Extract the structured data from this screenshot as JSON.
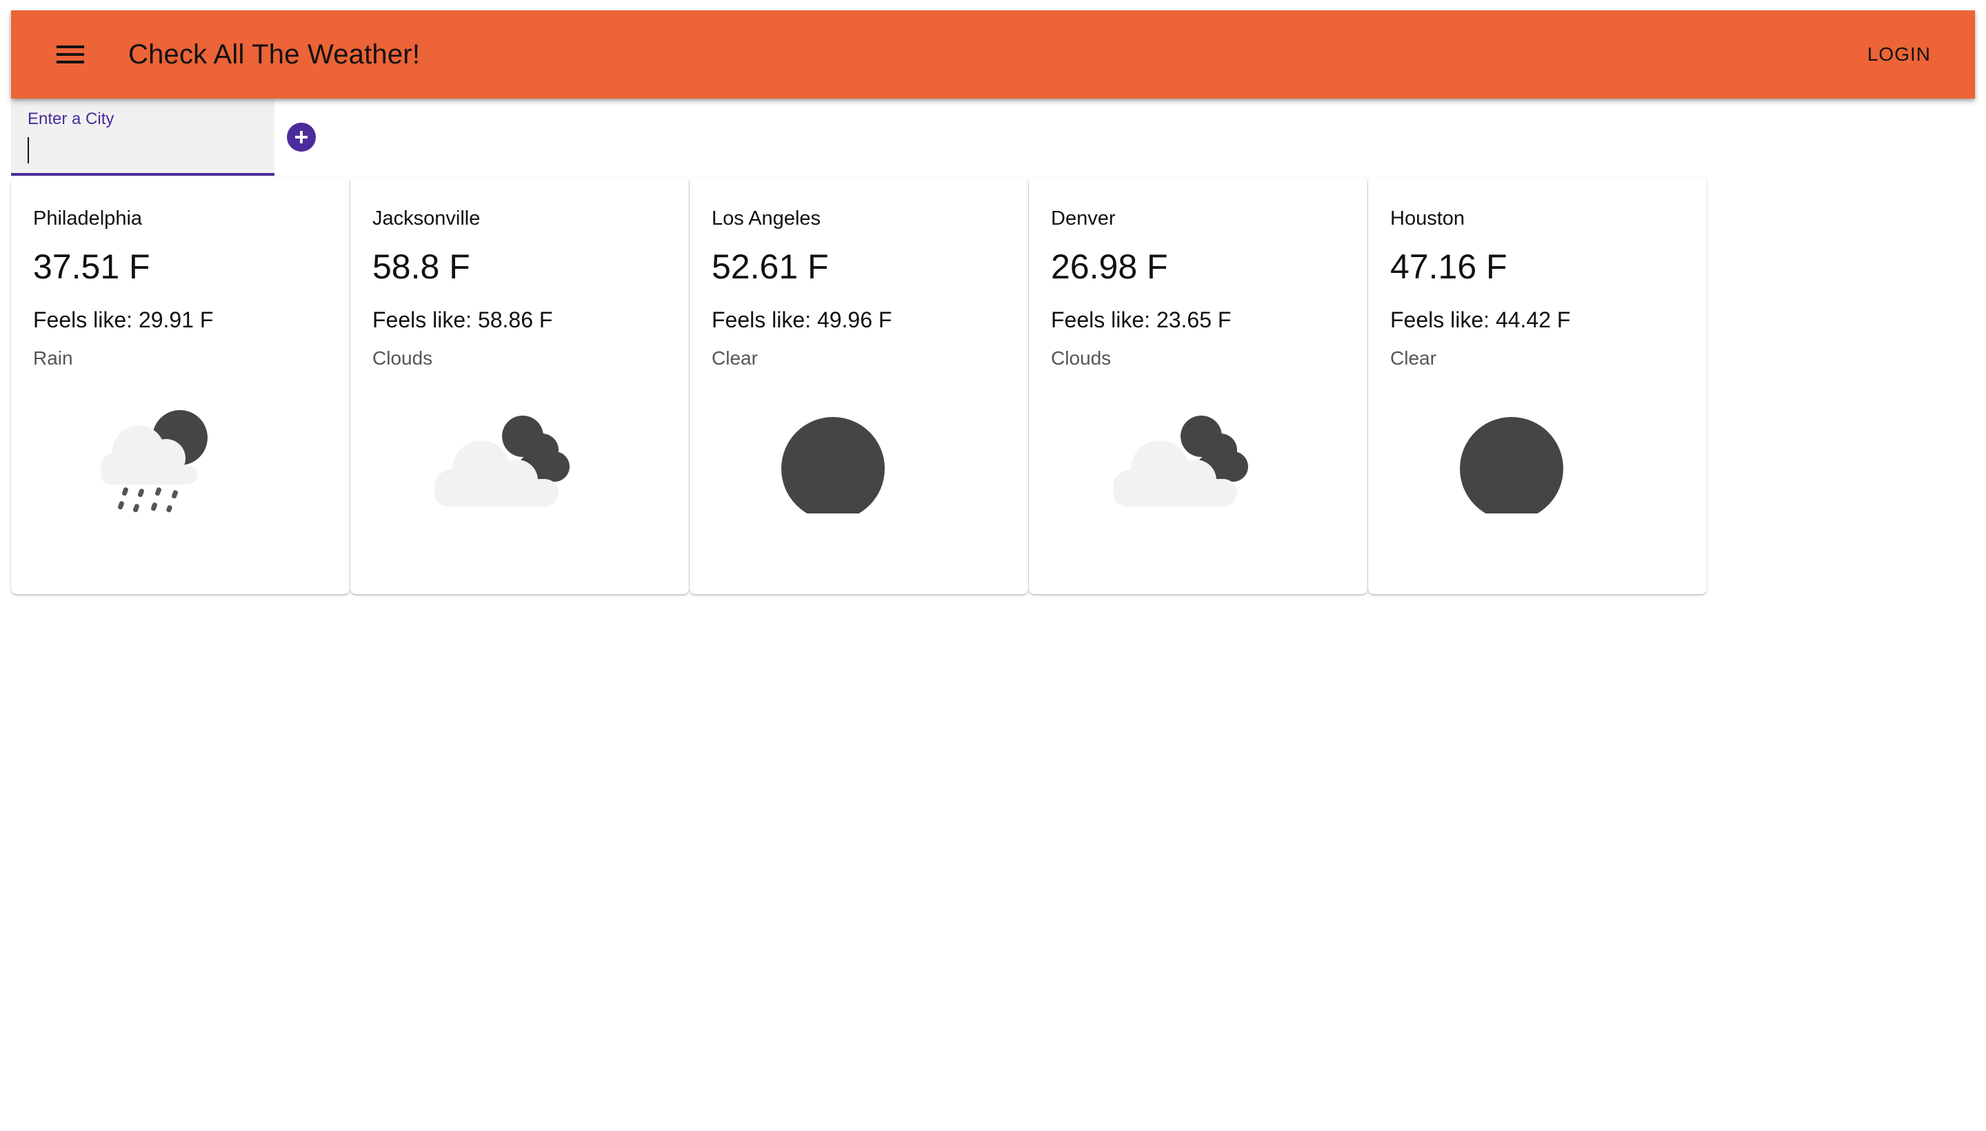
{
  "header": {
    "title": "Check All The Weather!",
    "login_label": "LOGIN",
    "menu_icon": "menu-icon",
    "bar_color": "#ec6437"
  },
  "search": {
    "label": "Enter a City",
    "value": "",
    "add_icon": "add-circle-icon",
    "accent_color": "#4a2c9a"
  },
  "cards": [
    {
      "city": "Philadelphia",
      "temp": "37.51 F",
      "feels": "Feels like: 29.91 F",
      "condition": "Rain",
      "icon": "rain-icon"
    },
    {
      "city": "Jacksonville",
      "temp": "58.8 F",
      "feels": "Feels like: 58.86 F",
      "condition": "Clouds",
      "icon": "clouds-icon"
    },
    {
      "city": "Los Angeles",
      "temp": "52.61 F",
      "feels": "Feels like: 49.96 F",
      "condition": "Clear",
      "icon": "clear-icon"
    },
    {
      "city": "Denver",
      "temp": "26.98 F",
      "feels": "Feels like: 23.65 F",
      "condition": "Clouds",
      "icon": "clouds-icon"
    },
    {
      "city": "Houston",
      "temp": "47.16 F",
      "feels": "Feels like: 44.42 F",
      "condition": "Clear",
      "icon": "clear-icon"
    }
  ]
}
